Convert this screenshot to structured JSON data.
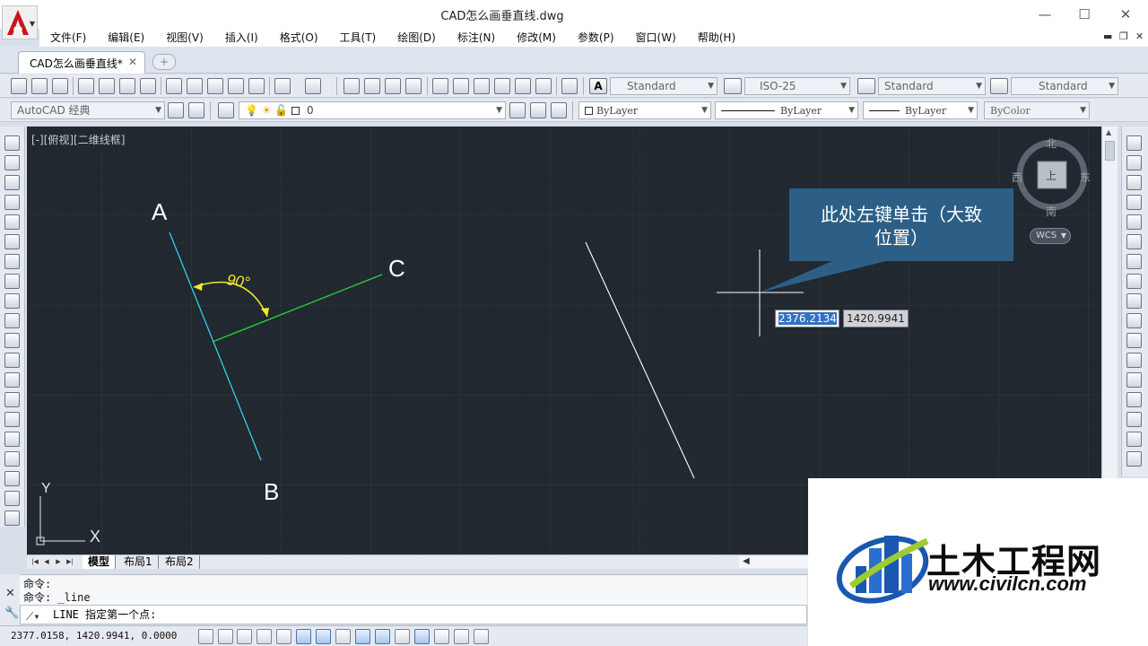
{
  "window": {
    "title": "CAD怎么画垂直线.dwg",
    "controls": [
      "—",
      "☐",
      "✕"
    ]
  },
  "menu": [
    "文件(F)",
    "编辑(E)",
    "视图(V)",
    "插入(I)",
    "格式(O)",
    "工具(T)",
    "绘图(D)",
    "标注(N)",
    "修改(M)",
    "参数(P)",
    "窗口(W)",
    "帮助(H)"
  ],
  "tabs": {
    "active_label": "CAD怎么画垂直线*",
    "close_glyph": "✕",
    "new_glyph": "+"
  },
  "toolbar1": {
    "text_style": "Standard",
    "dim_style": "ISO-25",
    "table_style": "Standard",
    "mleader_style": "Standard"
  },
  "toolbar2": {
    "workspace": "AutoCAD 经典",
    "layer": "0",
    "color": "ByLayer",
    "linetype": "ByLayer",
    "lineweight": "ByLayer",
    "plotstyle": "ByColor"
  },
  "viewport": {
    "label": "[-][俯视][二维线框]",
    "point_labels": {
      "a": "A",
      "b": "B",
      "c": "C"
    },
    "angle_label": "90°",
    "ucs_labels": {
      "x": "X",
      "y": "Y"
    },
    "colors": {
      "background": "#212830",
      "line_ab": "#2fd0e6",
      "line_c": "#22d63a",
      "angle": "#f5ea2a",
      "line_free": "#ffffff"
    }
  },
  "compass": {
    "north": "北",
    "south": "南",
    "east": "东",
    "west": "西",
    "top": "上",
    "wcs": "WCS"
  },
  "callout": {
    "text": "此处左键单击（大致位置）"
  },
  "dynamic_input": {
    "x": "2376.2134",
    "y": "1420.9941"
  },
  "layout_tabs": [
    "模型",
    "布局1",
    "布局2"
  ],
  "command": {
    "history": [
      "命令:",
      "命令: _line"
    ],
    "prompt": "LINE 指定第一个点:"
  },
  "status": {
    "coords": "2377.0158, 1420.9941, 0.0000"
  },
  "watermark": {
    "title": "土木工程网",
    "url": "www.civilcn.com"
  }
}
